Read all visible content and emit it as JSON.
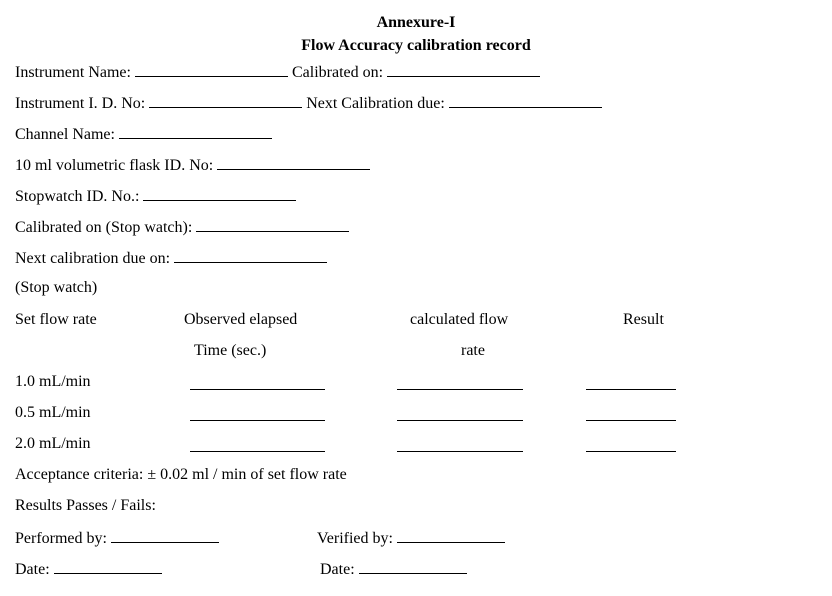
{
  "document": {
    "annexure": "Annexure-I",
    "title": "Flow Accuracy calibration record",
    "fields": {
      "instrument_name": "Instrument Name:",
      "calibrated_on": "Calibrated on:",
      "instrument_id": "Instrument I. D. No:",
      "next_calibration_due": "Next Calibration due:",
      "channel_name": "Channel Name:",
      "flask_id": "10 ml volumetric flask ID. No:",
      "stopwatch_id": "Stopwatch ID. No.:",
      "calibrated_on_stopwatch": "Calibrated on (Stop watch):",
      "next_calibration_due_on": "Next calibration due on:",
      "stop_watch_note": "(Stop watch)"
    },
    "table": {
      "headers": {
        "set_flow_rate": "Set flow rate",
        "observed_1": "Observed elapsed",
        "observed_2": "Time (sec.)",
        "calculated_1": "calculated flow",
        "calculated_2": "rate",
        "result": "Result"
      },
      "rows": [
        "1.0 mL/min",
        "0.5 mL/min",
        "2.0 mL/min"
      ]
    },
    "acceptance_criteria": "Acceptance criteria: ± 0.02 ml / min of set flow rate",
    "results": "Results Passes / Fails:",
    "performed_by": "Performed by:",
    "verified_by": "Verified by:",
    "date_left": "Date:",
    "date_right": "Date:"
  }
}
